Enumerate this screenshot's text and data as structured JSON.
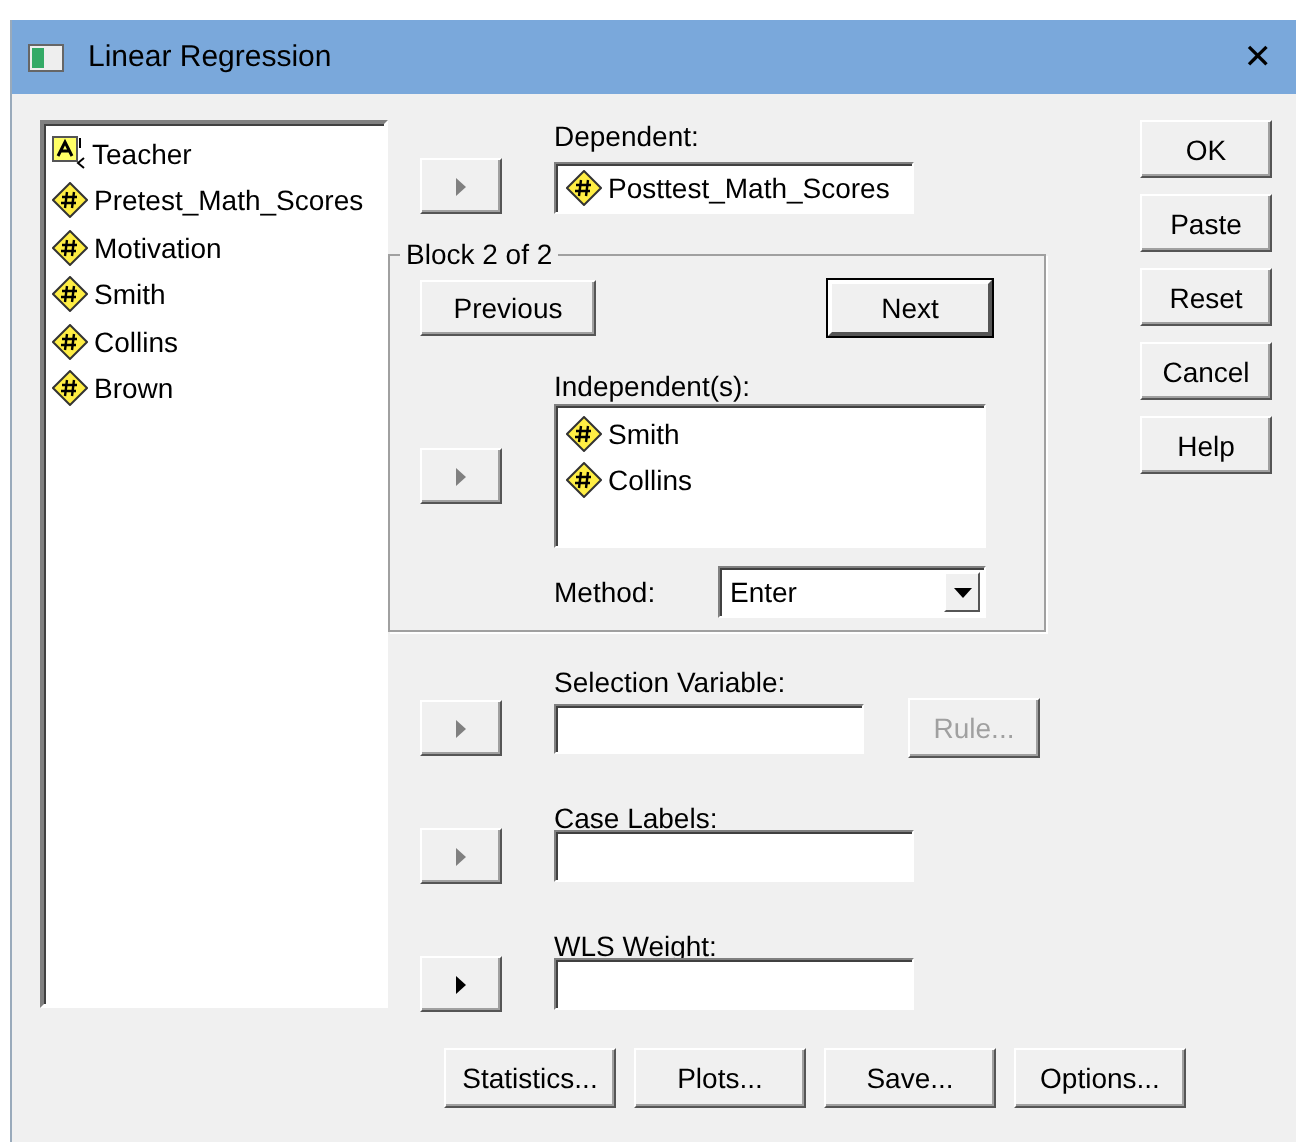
{
  "window": {
    "title": "Linear Regression",
    "close": "✕"
  },
  "variables": [
    {
      "name": "Teacher",
      "kind": "nominal"
    },
    {
      "name": "Pretest_Math_Scores",
      "kind": "scale"
    },
    {
      "name": "Motivation",
      "kind": "scale"
    },
    {
      "name": "Smith",
      "kind": "scale"
    },
    {
      "name": "Collins",
      "kind": "scale"
    },
    {
      "name": "Brown",
      "kind": "scale"
    }
  ],
  "dependent": {
    "label": "Dependent:",
    "arrow_disabled": true,
    "value": {
      "name": "Posttest_Math_Scores",
      "kind": "scale"
    }
  },
  "block": {
    "legend": "Block 2 of 2",
    "previous": "Previous",
    "next": "Next",
    "next_default": true,
    "independents_label": "Independent(s):",
    "arrow_disabled": true,
    "independents": [
      {
        "name": "Smith",
        "kind": "scale"
      },
      {
        "name": "Collins",
        "kind": "scale"
      }
    ],
    "method_label": "Method:",
    "method": "Enter"
  },
  "selection": {
    "label": "Selection Variable:",
    "arrow_disabled": true,
    "rule": "Rule...",
    "rule_disabled": true
  },
  "case_labels": {
    "label": "Case Labels:",
    "arrow_disabled": true
  },
  "wls_weight": {
    "label": "WLS Weight:",
    "arrow_disabled": false
  },
  "side_buttons": [
    "OK",
    "Paste",
    "Reset",
    "Cancel",
    "Help"
  ],
  "bottom_buttons": [
    "Statistics...",
    "Plots...",
    "Save...",
    "Options..."
  ]
}
